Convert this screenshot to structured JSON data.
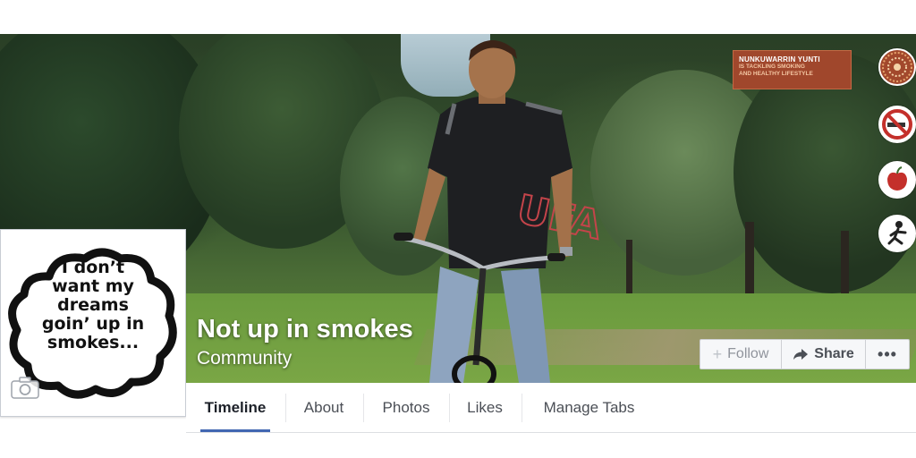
{
  "banner": {
    "line1": "NUNKUWARRIN YUNTI",
    "line2": "IS TACKLING SMOKING",
    "line3": "AND HEALTHY LIFESTYLE"
  },
  "profile": {
    "lines": [
      "I don’t",
      "want my",
      "dreams",
      "goin’ up in",
      "smokes..."
    ]
  },
  "page": {
    "name": "Not up in smokes",
    "category": "Community"
  },
  "actions": {
    "follow_label": "Follow",
    "share_label": "Share",
    "more_label": "•••"
  },
  "tabs": [
    {
      "label": "Timeline",
      "active": true
    },
    {
      "label": "About"
    },
    {
      "label": "Photos"
    },
    {
      "label": "Likes"
    },
    {
      "label": "Manage Tabs"
    }
  ],
  "colors": {
    "accent": "#4267b2",
    "banner": "#a0472c"
  },
  "icons": {
    "cover_side": [
      "aboriginal-dot-art-icon",
      "no-smoking-icon",
      "apple-icon",
      "running-person-icon"
    ],
    "profile": "camera-icon",
    "follow": "plus-icon",
    "share": "share-arrow-icon"
  }
}
